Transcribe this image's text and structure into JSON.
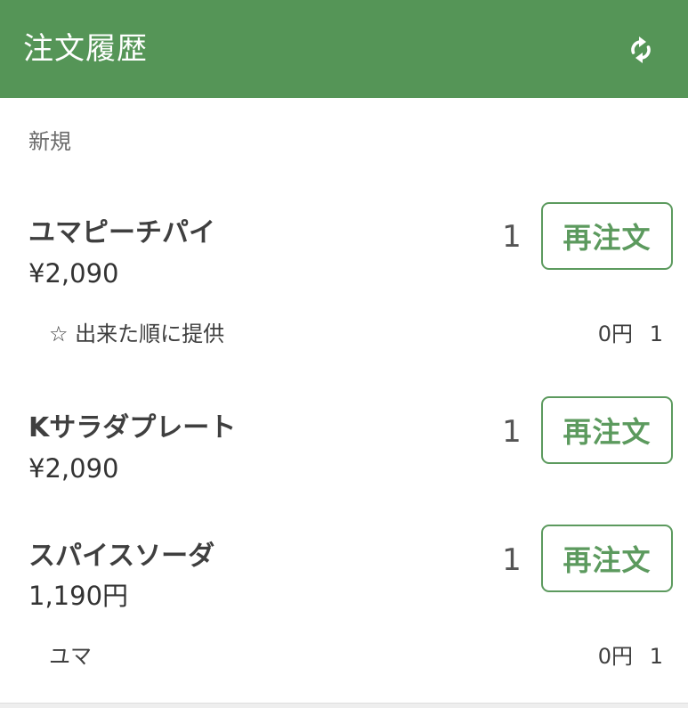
{
  "header": {
    "title": "注文履歴",
    "refresh_icon": "refresh-icon",
    "background": "#559557"
  },
  "section": {
    "label": "新規"
  },
  "orders": [
    {
      "name": "ユマピーチパイ",
      "price": "¥2,090",
      "quantity": "1",
      "reorder_label": "再注文",
      "options": [
        {
          "name": "☆ 出来た順に提供",
          "price": "0円",
          "quantity": "1"
        }
      ]
    },
    {
      "name": "Kサラダプレート",
      "price": "¥2,090",
      "quantity": "1",
      "reorder_label": "再注文",
      "options": []
    },
    {
      "name": "スパイスソーダ",
      "price": "1,190円",
      "quantity": "1",
      "reorder_label": "再注文",
      "options": [
        {
          "name": "ユマ",
          "price": "0円",
          "quantity": "1"
        }
      ]
    }
  ],
  "colors": {
    "accent": "#5c9a5e",
    "text": "#333333",
    "muted": "#6b6b6b"
  }
}
